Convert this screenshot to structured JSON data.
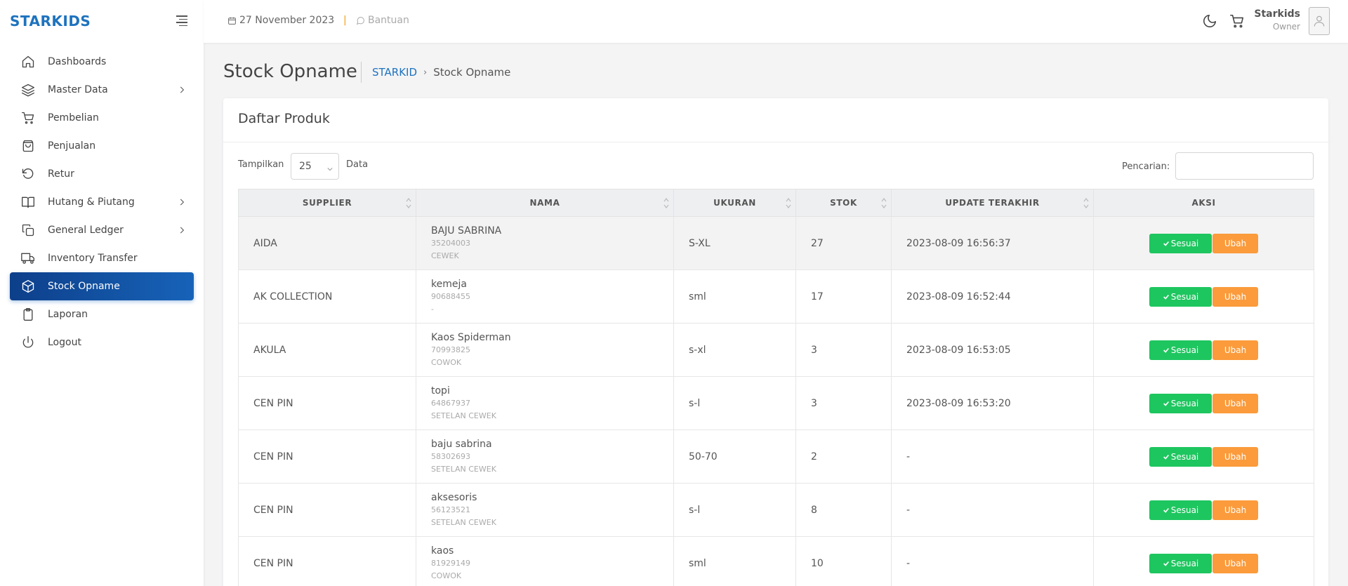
{
  "brand": "STARKIDS",
  "sidebar": {
    "items": [
      {
        "label": "Dashboards",
        "icon": "home-icon"
      },
      {
        "label": "Master Data",
        "icon": "layers-icon"
      },
      {
        "label": "Pembelian",
        "icon": "cart-icon"
      },
      {
        "label": "Penjualan",
        "icon": "shopping-bag-icon"
      },
      {
        "label": "Retur",
        "icon": "rotate-ccw-icon"
      },
      {
        "label": "Hutang & Piutang",
        "icon": "book-icon"
      },
      {
        "label": "General Ledger",
        "icon": "copy-icon"
      },
      {
        "label": "Inventory Transfer",
        "icon": "truck-icon"
      },
      {
        "label": "Stock Opname",
        "icon": "box-icon",
        "active": true
      },
      {
        "label": "Laporan",
        "icon": "clipboard-icon"
      },
      {
        "label": "Logout",
        "icon": "power-icon"
      }
    ]
  },
  "header": {
    "date": "27 November 2023",
    "separator": "|",
    "help": "Bantuan",
    "user_name": "Starkids",
    "user_role": "Owner"
  },
  "page": {
    "title": "Stock Opname",
    "breadcrumb_home": "STARKID",
    "breadcrumb_arrow": "›",
    "breadcrumb_current": "Stock Opname"
  },
  "card": {
    "title": "Daftar Produk",
    "length_label": "Tampilkan",
    "length_value": "25",
    "length_suffix": "Data",
    "search_label": "Pencarian:",
    "search_value": ""
  },
  "table": {
    "columns": [
      "SUPPLIER",
      "NAMA",
      "UKURAN",
      "STOK",
      "UPDATE TERAKHIR",
      "AKSI"
    ],
    "action_ok": "Sesuai",
    "action_edit": "Ubah",
    "rows": [
      {
        "supplier": "AIDA",
        "name": "BAJU SABRINA",
        "code": "35204003",
        "category": "CEWEK",
        "size": "S-XL",
        "stock": "27",
        "updated": "2023-08-09 16:56:37"
      },
      {
        "supplier": "AK COLLECTION",
        "name": "kemeja",
        "code": "90688455",
        "category": "-",
        "size": "sml",
        "stock": "17",
        "updated": "2023-08-09 16:52:44"
      },
      {
        "supplier": "AKULA",
        "name": "Kaos Spiderman",
        "code": "70993825",
        "category": "COWOK",
        "size": "s-xl",
        "stock": "3",
        "updated": "2023-08-09 16:53:05"
      },
      {
        "supplier": "CEN PIN",
        "name": "topi",
        "code": "64867937",
        "category": "SETELAN CEWEK",
        "size": "s-l",
        "stock": "3",
        "updated": "2023-08-09 16:53:20"
      },
      {
        "supplier": "CEN PIN",
        "name": "baju sabrina",
        "code": "58302693",
        "category": "SETELAN CEWEK",
        "size": "50-70",
        "stock": "2",
        "updated": "-"
      },
      {
        "supplier": "CEN PIN",
        "name": "aksesoris",
        "code": "56123521",
        "category": "SETELAN CEWEK",
        "size": "s-l",
        "stock": "8",
        "updated": "-"
      },
      {
        "supplier": "CEN PIN",
        "name": "kaos",
        "code": "81929149",
        "category": "COWOK",
        "size": "sml",
        "stock": "10",
        "updated": "-"
      }
    ]
  }
}
